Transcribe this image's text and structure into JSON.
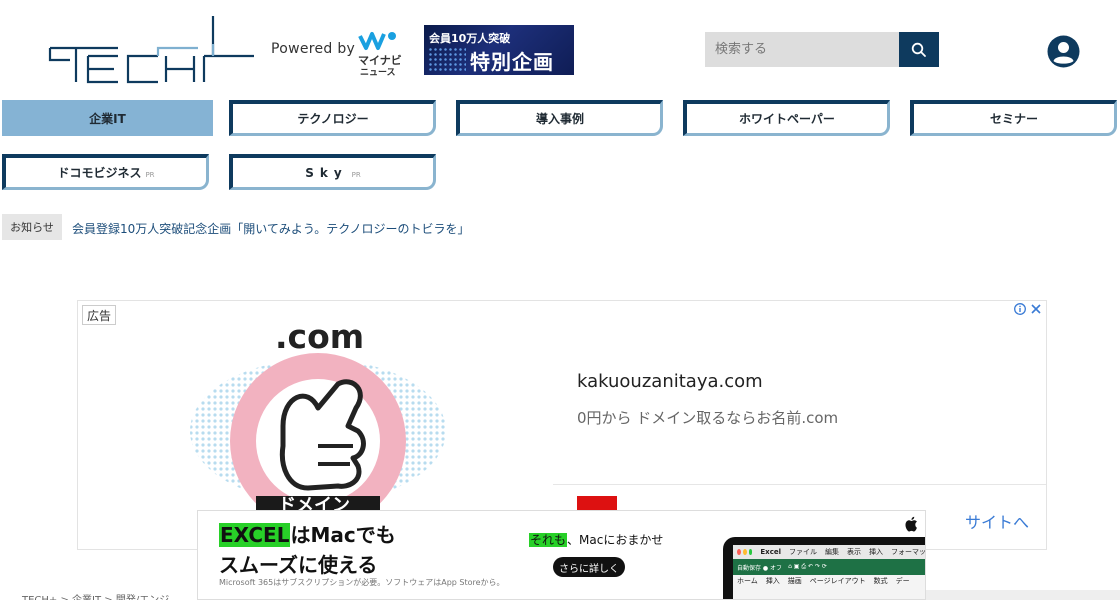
{
  "header": {
    "logo_text": "TECH+",
    "powered_by": "Powered by",
    "mynavi_line1": "マイナビ",
    "mynavi_line2": "ニュース",
    "banner_line1": "会員10万人突破",
    "banner_line2": "特別企画"
  },
  "search": {
    "placeholder": "検索する"
  },
  "nav": {
    "items": [
      {
        "label": "企業IT",
        "active": true
      },
      {
        "label": "テクノロジー"
      },
      {
        "label": "導入事例"
      },
      {
        "label": "ホワイトペーパー"
      },
      {
        "label": "セミナー"
      },
      {
        "label": "ドコモビジネス",
        "pr": "PR"
      },
      {
        "label": "Sky",
        "pr": "PR"
      }
    ]
  },
  "notice": {
    "label": "お知らせ",
    "text": "会員登録10万人突破記念企画「開いてみよう。テクノロジーのトビラを」"
  },
  "ad1": {
    "tag": "広告",
    "dotcom": ".com",
    "domain_badge": "ドメイン",
    "domain": "kakuouzanitaya.com",
    "description": "0円から ドメイン取るならお名前.com",
    "cta": "サイトへ"
  },
  "ad2": {
    "headline_hl": "EXCEL",
    "headline_rest": "はMacでも",
    "headline2": "スムーズに使える",
    "small": "Microsoft 365はサブスクリプションが必要。ソフトウェアはApp Storeから。",
    "tagline_hl": "それも",
    "tagline_rest": "、Macにおまかせ",
    "button": "さらに詳しく",
    "laptop_menu": [
      "Excel",
      "ファイル",
      "編集",
      "表示",
      "挿入",
      "フォーマット"
    ],
    "laptop_toolbar": "自動保存 ● オフ",
    "laptop_ribbon": [
      "ホーム",
      "挿入",
      "描画",
      "ページレイアウト",
      "数式",
      "デー"
    ]
  },
  "breadcrumb": "TECH+  >  企業IT  >  開発/エンジ"
}
